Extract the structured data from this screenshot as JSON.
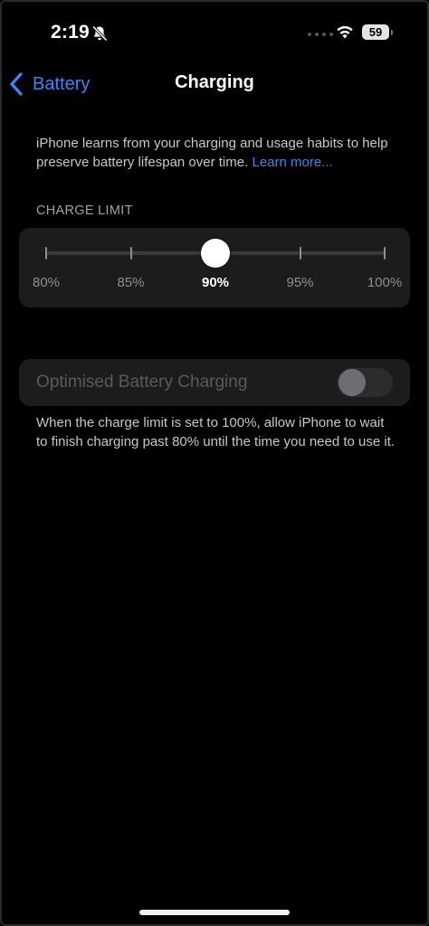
{
  "status_bar": {
    "time": "2:19",
    "battery_level": "59",
    "icons": [
      "bell-slash-icon",
      "wifi-icon",
      "battery-icon"
    ]
  },
  "nav": {
    "back_label": "Battery",
    "title": "Charging"
  },
  "intro": {
    "text": "iPhone learns from your charging and usage habits to help preserve battery lifespan over time.",
    "link": "Learn more..."
  },
  "charge_limit": {
    "header": "CHARGE LIMIT",
    "options": [
      "80%",
      "85%",
      "90%",
      "95%",
      "100%"
    ],
    "selected_index": 2,
    "selected_value": "90%"
  },
  "optimised": {
    "label": "Optimised Battery Charging",
    "enabled": false,
    "toggle_on": false,
    "note": "When the charge limit is set to 100%, allow iPhone to wait to finish charging past 80% until the time you need to use it."
  },
  "colors": {
    "accent": "#3a87f5",
    "background": "#000000",
    "card": "#1c1c1e"
  }
}
